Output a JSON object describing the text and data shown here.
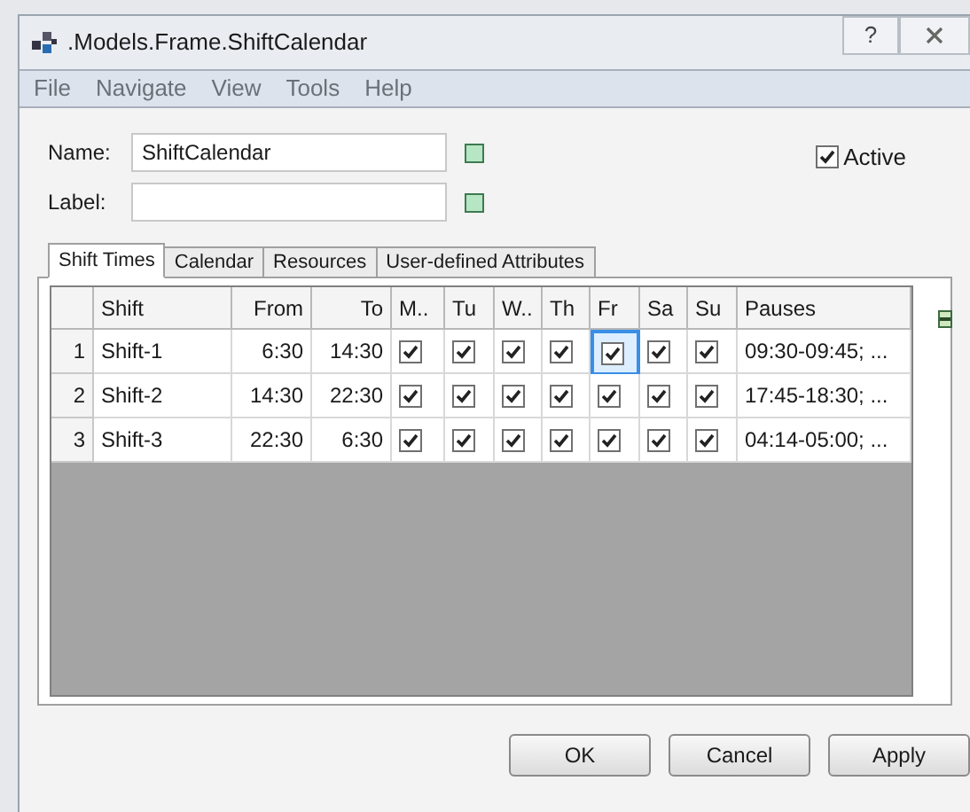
{
  "window": {
    "title": ".Models.Frame.ShiftCalendar",
    "help": "?"
  },
  "menu": [
    "File",
    "Navigate",
    "View",
    "Tools",
    "Help"
  ],
  "fields": [
    {
      "label": "Name:",
      "value": "ShiftCalendar"
    },
    {
      "label": "Label:"
    }
  ],
  "active": {
    "label": "Active",
    "checked": true
  },
  "tabs": [
    {
      "label": "Shift Times",
      "selected": true
    },
    {
      "label": "Calendar",
      "selected": false
    },
    {
      "label": "Resources",
      "selected": false
    },
    {
      "label": "User-defined Attributes",
      "selected": false
    }
  ],
  "table": {
    "columns": [
      "Shift",
      "From",
      "To",
      "M..",
      "Tu",
      "W..",
      "Th",
      "Fr",
      "Sa",
      "Su",
      "Pauses"
    ],
    "rows": [
      {
        "number": "1",
        "shift": "Shift-1",
        "from": "6:30",
        "to": "14:30",
        "days": [
          {
            "checked": true,
            "selected": false
          },
          {
            "checked": true,
            "selected": false
          },
          {
            "checked": true,
            "selected": false
          },
          {
            "checked": true,
            "selected": false
          },
          {
            "checked": true,
            "selected": true
          },
          {
            "checked": true,
            "selected": false
          },
          {
            "checked": true,
            "selected": false
          }
        ],
        "pauses": "09:30-09:45; ..."
      },
      {
        "number": "2",
        "shift": "Shift-2",
        "from": "14:30",
        "to": "22:30",
        "days": [
          {
            "checked": true,
            "selected": false
          },
          {
            "checked": true,
            "selected": false
          },
          {
            "checked": true,
            "selected": false
          },
          {
            "checked": true,
            "selected": false
          },
          {
            "checked": true,
            "selected": false
          },
          {
            "checked": true,
            "selected": false
          },
          {
            "checked": true,
            "selected": false
          }
        ],
        "pauses": "17:45-18:30; ..."
      },
      {
        "number": "3",
        "shift": "Shift-3",
        "from": "22:30",
        "to": "6:30",
        "days": [
          {
            "checked": true,
            "selected": false
          },
          {
            "checked": true,
            "selected": false
          },
          {
            "checked": true,
            "selected": false
          },
          {
            "checked": true,
            "selected": false
          },
          {
            "checked": true,
            "selected": false
          },
          {
            "checked": true,
            "selected": false
          },
          {
            "checked": true,
            "selected": false
          }
        ],
        "pauses": "04:14-05:00; ..."
      }
    ]
  },
  "buttons": [
    "OK",
    "Cancel",
    "Apply"
  ]
}
